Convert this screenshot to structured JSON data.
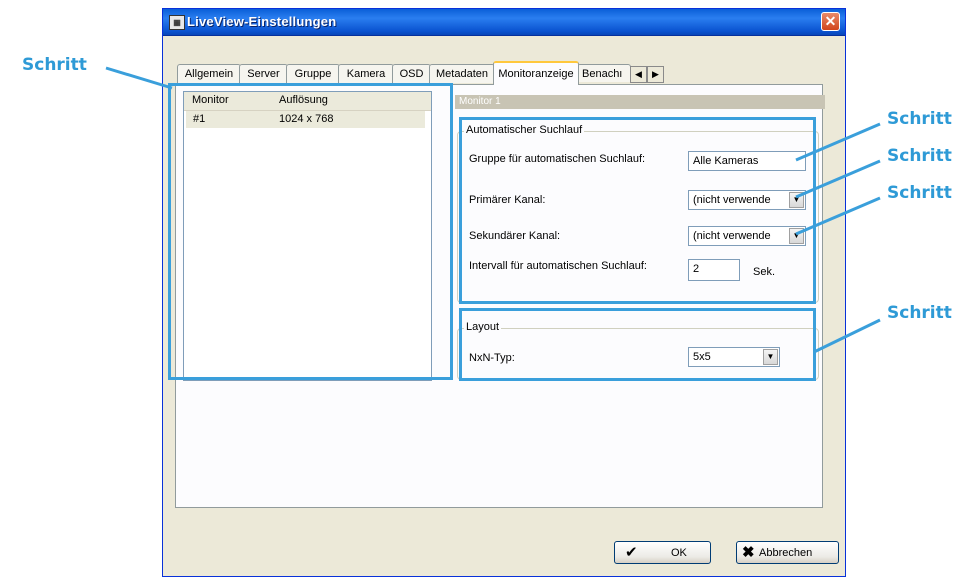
{
  "callouts": {
    "left": "Schritt",
    "r1": "Schritt",
    "r2": "Schritt",
    "r3": "Schritt",
    "r4": "Schritt"
  },
  "dialog": {
    "title": "LiveView-Einstellungen",
    "close_glyph": "✕",
    "tabs": [
      "Allgemein",
      "Server",
      "Gruppe",
      "Kamera",
      "OSD",
      "Metadaten",
      "Monitoranzeige",
      "Benachı"
    ],
    "active_tab": "Monitoranzeige",
    "scroll_left": "◀",
    "scroll_right": "▶"
  },
  "monitor_list": {
    "headers": [
      "Monitor",
      "Auflösung"
    ],
    "rows": [
      {
        "monitor": "#1",
        "resolution": "1024 x 768"
      }
    ]
  },
  "monitor_strip_label": "Monitor 1",
  "auto_scan": {
    "title": "Automatischer Suchlauf",
    "group_label": "Gruppe für automatischen Suchlauf:",
    "group_value": "Alle Kameras",
    "primary_label": "Primärer Kanal:",
    "primary_value": "(nicht verwende",
    "secondary_label": "Sekundärer Kanal:",
    "secondary_value": "(nicht verwende",
    "interval_label": "Intervall für automatischen Suchlauf:",
    "interval_value": "2",
    "interval_unit": "Sek."
  },
  "layout": {
    "title": "Layout",
    "type_label": "NxN-Typ:",
    "type_value": "5x5"
  },
  "buttons": {
    "ok": "OK",
    "cancel": "Abbrechen"
  },
  "colors": {
    "accent_callout": "#2e9ad6",
    "titlebar": "#0a5fd8",
    "highlight_frame": "#3a9fdb"
  }
}
